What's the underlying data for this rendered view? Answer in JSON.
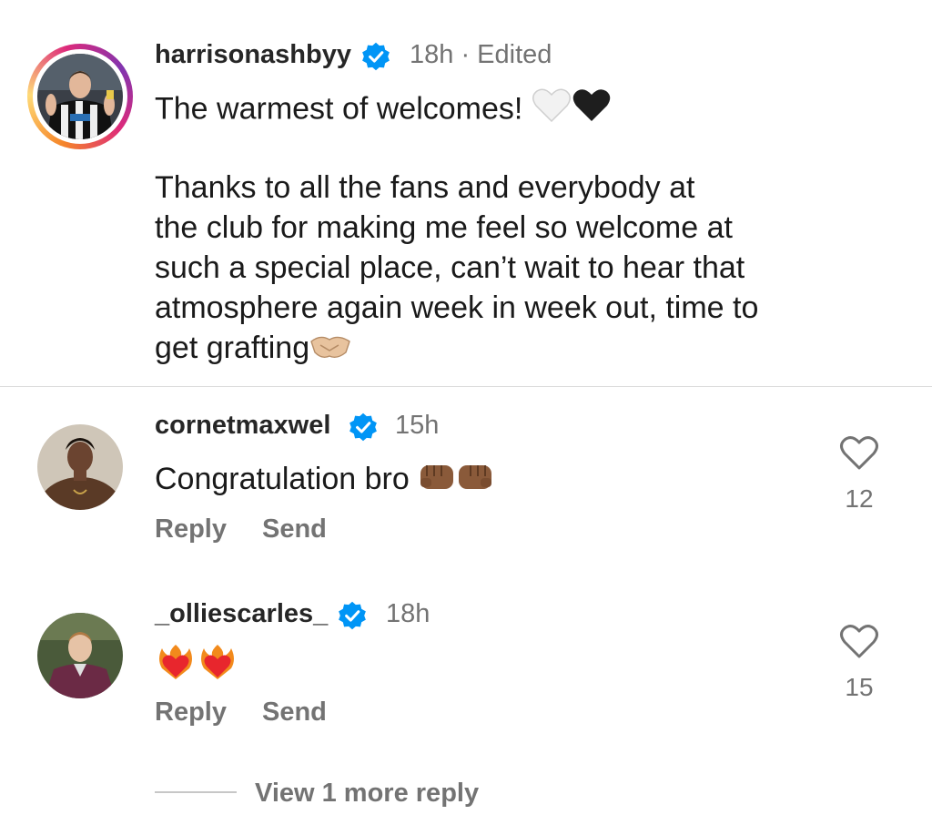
{
  "caption": {
    "username": "harrisonashbyy",
    "meta": "18h · Edited",
    "line1": "The warmest of welcomes!",
    "paragraph_lines": [
      "Thanks to all the fans and everybody at",
      "the club for making me feel so welcome at",
      "such a special place, can’t wait to hear that",
      "atmosphere again week in week out, time to",
      "get grafting"
    ],
    "emojis": [
      "white-heart",
      "black-heart",
      "handshake"
    ]
  },
  "comments": [
    {
      "username": "cornetmaxwel",
      "time": "15h",
      "text": "Congratulation bro",
      "emojis": [
        "fist-bump-brown",
        "fist-bump-brown"
      ],
      "like_count": "12",
      "reply_label": "Reply",
      "send_label": "Send"
    },
    {
      "username": "_olliescarles_",
      "time": "18h",
      "text": "",
      "emojis": [
        "heart-on-fire",
        "heart-on-fire"
      ],
      "like_count": "15",
      "reply_label": "Reply",
      "send_label": "Send"
    }
  ],
  "view_more": "View 1 more reply",
  "colors": {
    "verified": "#0095f6",
    "muted": "#737373",
    "divider": "#dbdbdb"
  }
}
